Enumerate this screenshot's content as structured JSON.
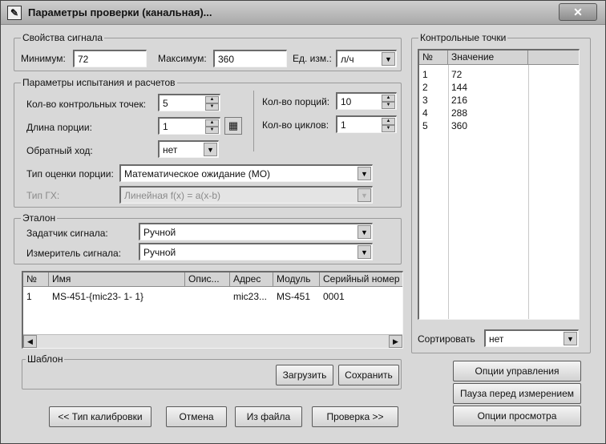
{
  "window": {
    "title": "Параметры проверки (канальная)...",
    "close_label": "✕"
  },
  "signal_props": {
    "legend": "Свойства сигнала",
    "min_label": "Минимум:",
    "min_value": "72",
    "max_label": "Максимум:",
    "max_value": "360",
    "unit_label": "Ед. изм.:",
    "unit_value": "л/ч"
  },
  "test_params": {
    "legend": "Параметры испытания и расчетов",
    "points_label": "Кол-во контрольных точек:",
    "points_value": "5",
    "portion_len_label": "Длина порции:",
    "portion_len_value": "1",
    "reverse_label": "Обратный ход:",
    "reverse_value": "нет",
    "portions_label": "Кол-во порций:",
    "portions_value": "10",
    "cycles_label": "Кол-во циклов:",
    "cycles_value": "1",
    "estimate_label": "Тип оценки порции:",
    "estimate_value": "Математическое ожидание (МО)",
    "gh_label": "Тип ГХ:",
    "gh_value": "Линейная f(x) = a(x-b)"
  },
  "etalon": {
    "legend": "Эталон",
    "setter_label": "Задатчик сигнала:",
    "setter_value": "Ручной",
    "meter_label": "Измеритель сигнала:",
    "meter_value": "Ручной"
  },
  "devices_table": {
    "columns": [
      "№",
      "Имя",
      "Опис...",
      "Адрес",
      "Модуль",
      "Серийный номер"
    ],
    "rows": [
      [
        "1",
        "MS-451-{mic23- 1- 1}",
        "",
        "mic23...",
        "MS-451",
        "0001"
      ]
    ]
  },
  "template": {
    "legend": "Шаблон",
    "load_label": "Загрузить",
    "save_label": "Сохранить"
  },
  "control_points": {
    "legend": "Контрольные точки",
    "columns": [
      "№",
      "Значение"
    ],
    "rows": [
      [
        "1",
        "72"
      ],
      [
        "2",
        "144"
      ],
      [
        "3",
        "216"
      ],
      [
        "4",
        "288"
      ],
      [
        "5",
        "360"
      ]
    ],
    "sort_label": "Сортировать",
    "sort_value": "нет"
  },
  "side_buttons": {
    "control_options": "Опции управления",
    "pause": "Пауза перед измерением",
    "view_options": "Опции просмотра"
  },
  "bottom_buttons": {
    "calib_type": "<< Тип калибровки",
    "cancel": "Отмена",
    "from_file": "Из файла",
    "check": "Проверка >>"
  },
  "icons": {
    "app": "calibration-app-icon",
    "close": "close-icon",
    "dropdown": "chevron-down-icon",
    "spin": "spin-arrows-icon",
    "table": "table-editor-icon"
  }
}
